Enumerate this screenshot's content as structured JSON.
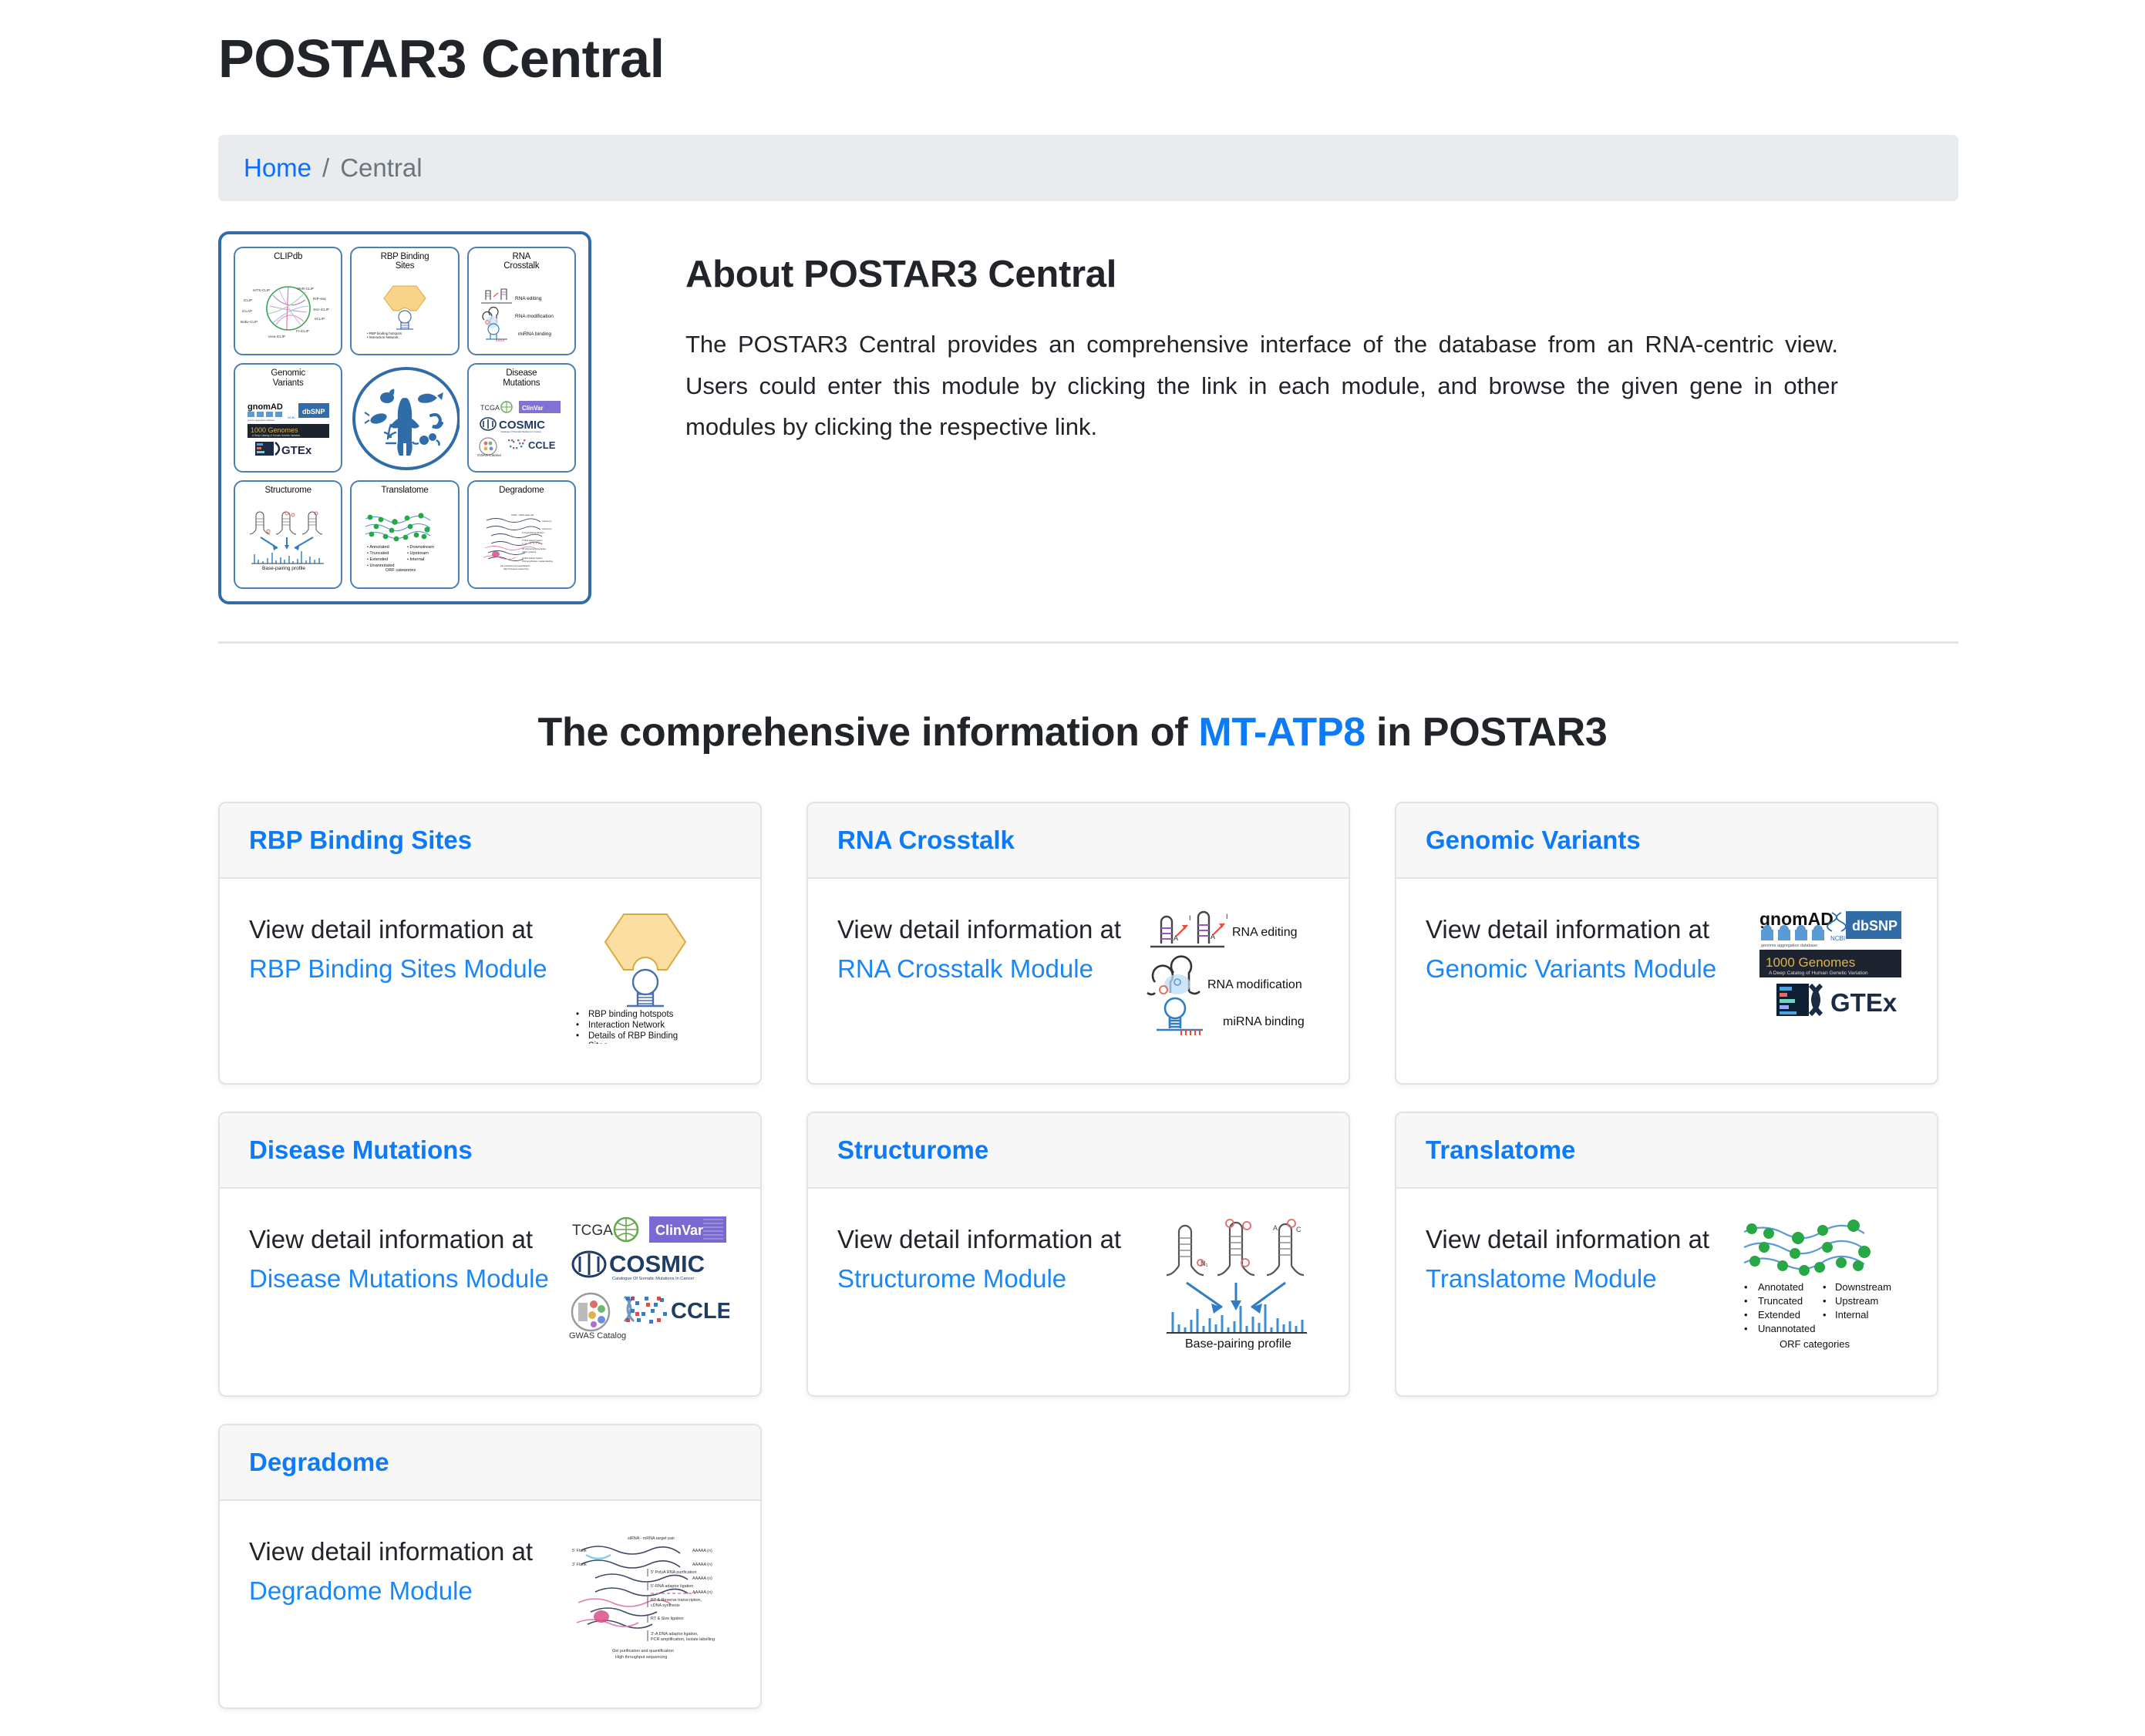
{
  "page": {
    "title": "POSTAR3 Central"
  },
  "breadcrumb": {
    "home_label": "Home",
    "separator": "/",
    "current_label": "Central"
  },
  "overview_figure": {
    "alt": "postar3-modules-overview",
    "cells": [
      {
        "title": "CLIPdb",
        "icon": "circos-plot-icon",
        "labels": [
          "HITS-CLIP",
          "PAR-CLIP",
          "iCLIP",
          "RIP-seq",
          "iCLAP",
          "4sU-iCLIP",
          "BrdU-CLIP",
          "eCLIP",
          "irCLIP",
          "FI-iCLIP",
          "urea-iCLIP"
        ]
      },
      {
        "title": "RBP Binding\nSites",
        "icon": "rbp-hexagon-icon",
        "bullets": [
          "RBP binding hotspots",
          "Interaction Network",
          "Details of RBP Binding Sites"
        ]
      },
      {
        "title": "RNA\nCrosstalk",
        "icon": "rna-crosstalk-icon",
        "labels": [
          "RNA editing",
          "RNA modification",
          "miRNA binding"
        ]
      },
      {
        "title": "Genomic\nVariants",
        "icon": "variants-logos-icon",
        "labels": [
          "gnomAD",
          "NCBI dbSNP",
          "1000 Genomes",
          "GTEx"
        ]
      },
      {
        "title": "",
        "icon": "organisms-circle-icon",
        "labels": [
          "mouse",
          "fish",
          "fly",
          "human",
          "worm",
          "plant",
          "yeast"
        ]
      },
      {
        "title": "Disease\nMutations",
        "icon": "disease-logos-icon",
        "labels": [
          "TCGA",
          "ClinVar",
          "COSMIC",
          "GWAS Catalog",
          "CCLE"
        ]
      },
      {
        "title": "Structurome",
        "icon": "base-pairing-icon",
        "labels": [
          "Base-pairing profile"
        ]
      },
      {
        "title": "Translatome",
        "icon": "orf-categories-icon",
        "labels": [
          "Annotated",
          "Truncated",
          "Extended",
          "Unannotated",
          "Downstream",
          "Upstream",
          "Internal",
          "ORF categories"
        ]
      },
      {
        "title": "Degradome",
        "icon": "degradome-icon",
        "labels": []
      }
    ]
  },
  "about": {
    "heading": "About POSTAR3 Central",
    "paragraph": "The POSTAR3 Central provides an comprehensive interface of the database from an RNA-centric view. Users could enter this module by clicking the link in each module, and browse the given gene in other modules by clicking the respective link."
  },
  "section": {
    "heading_prefix": "The comprehensive information of ",
    "gene": "MT-ATP8",
    "heading_suffix": " in POSTAR3"
  },
  "cards": [
    {
      "title": "RBP Binding Sites",
      "text": "View detail information at",
      "link_label": "RBP Binding Sites Module",
      "thumb_icon": "rbp-hexagon-icon",
      "thumb_labels": [
        "RBP binding hotspots",
        "Interaction Network",
        "Details of RBP Binding",
        "Sites"
      ]
    },
    {
      "title": "RNA Crosstalk",
      "text": "View detail information at",
      "link_label": "RNA Crosstalk Module",
      "thumb_icon": "rna-crosstalk-icon",
      "thumb_labels": [
        "RNA editing",
        "RNA modification",
        "miRNA binding"
      ]
    },
    {
      "title": "Genomic Variants",
      "text": "View detail information at",
      "link_label": "Genomic Variants Module",
      "thumb_icon": "variants-logos-icon",
      "thumb_labels": [
        "gnomAD",
        "genome aggregation database",
        "NCBI",
        "dbSNP",
        "1000 Genomes",
        "A Deep Catalog of Human Genetic Variation",
        "GTEx"
      ]
    },
    {
      "title": "Disease Mutations",
      "text": "View detail information at",
      "link_label": "Disease Mutations Module",
      "thumb_icon": "disease-logos-icon",
      "thumb_labels": [
        "TCGA",
        "ClinVar",
        "COSMIC",
        "Catalogue Of Somatic Mutations In Cancer",
        "GWAS Catalog",
        "CCLE"
      ]
    },
    {
      "title": "Structurome",
      "text": "View detail information at",
      "link_label": "Structurome Module",
      "thumb_icon": "base-pairing-icon",
      "thumb_labels": [
        "Base-pairing profile"
      ]
    },
    {
      "title": "Translatome",
      "text": "View detail information at",
      "link_label": "Translatome Module",
      "thumb_icon": "orf-categories-icon",
      "thumb_labels": [
        "Annotated",
        "Downstream",
        "Truncated",
        "Upstream",
        "Extended",
        "Internal",
        "Unannotated",
        "ORF categories"
      ]
    },
    {
      "title": "Degradome",
      "text": "View detail information at",
      "link_label": "Degradome Module",
      "thumb_icon": "degradome-icon",
      "thumb_labels": []
    }
  ],
  "colors": {
    "link_blue": "#0d7bf7",
    "breadcrumb_bg": "#e9ecef",
    "card_header_bg": "#f7f7f7",
    "diagram_blue": "#2f6ca8",
    "text_dark": "#212529",
    "muted": "#6c757d"
  }
}
